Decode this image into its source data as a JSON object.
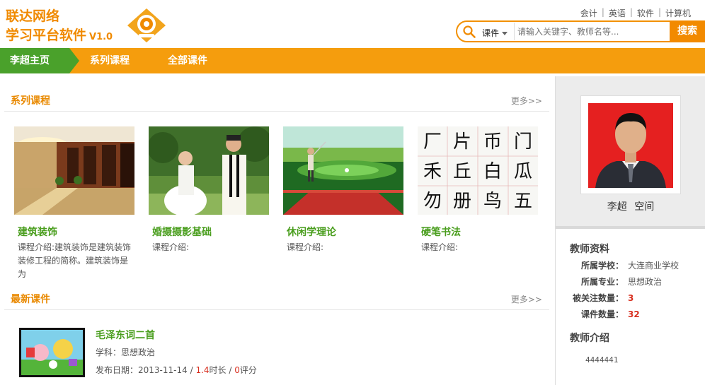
{
  "brand": {
    "line1": "联达网络",
    "line2": "学习平台软件",
    "version": "V1.0"
  },
  "top_links": [
    "会计",
    "英语",
    "软件",
    "计算机"
  ],
  "search": {
    "category": "课件",
    "placeholder": "请输入关键字、教师名等...",
    "button": "搜索"
  },
  "nav": {
    "home": "李超主页",
    "items": [
      "系列课程",
      "全部课件"
    ]
  },
  "series": {
    "title": "系列课程",
    "more": "更多>>",
    "courses": [
      {
        "title": "建筑装饰",
        "desc": "课程介绍:建筑装饰是建筑装饰装修工程的简称。建筑装饰是为"
      },
      {
        "title": "婚摄摄影基础",
        "desc": "课程介绍:"
      },
      {
        "title": "休闲学理论",
        "desc": "课程介绍:"
      },
      {
        "title": "硬笔书法",
        "desc": "课程介绍:"
      }
    ],
    "calligraphy_chars": [
      "厂",
      "片",
      "币",
      "门",
      "禾",
      "丘",
      "白",
      "瓜",
      "勿",
      "册",
      "鸟",
      "五"
    ]
  },
  "latest": {
    "title": "最新课件",
    "more": "更多>>",
    "item": {
      "title": "毛泽东词二首",
      "subject": "学科：思想政治",
      "date_label": "发布日期：",
      "date": "2013-11-14",
      "sep": " / ",
      "duration": "1.4",
      "duration_unit": "时长",
      "score": "0",
      "score_unit": "评分"
    }
  },
  "teacher": {
    "name": "李超",
    "space": "空间",
    "info_title": "教师资料",
    "school_label": "所属学校：",
    "school": "大连商业学校",
    "major_label": "所属专业：",
    "major": "思想政治",
    "followers_label": "被关注数量：",
    "followers": "3",
    "courses_label": "课件数量：",
    "courses": "32",
    "intro_title": "教师介绍",
    "intro": "4444441"
  },
  "colors": {
    "brand_orange": "#f08a00",
    "nav_orange": "#f59d0d",
    "home_green": "#4aa12b",
    "link_green": "#4a9e1e",
    "number_red": "#d83020"
  }
}
